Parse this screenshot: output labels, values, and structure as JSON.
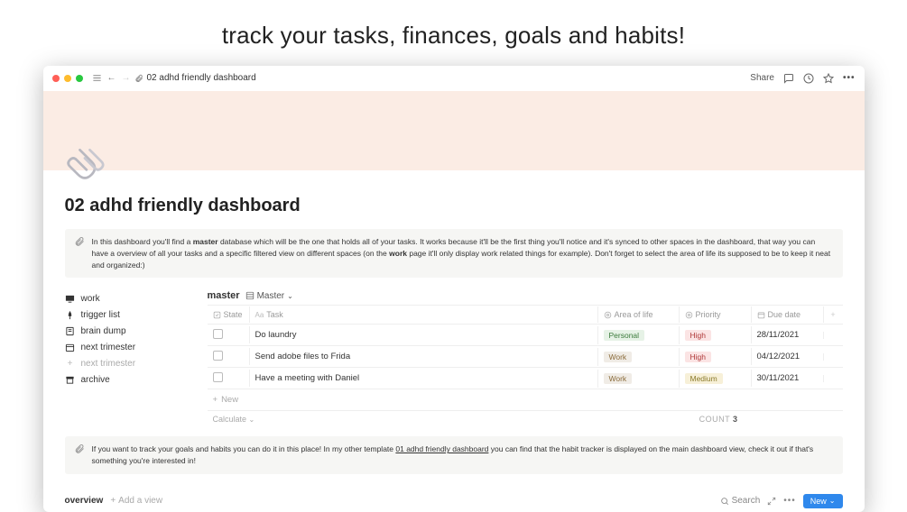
{
  "marketing_header": "track your tasks, finances, goals and habits!",
  "topbar": {
    "breadcrumb_title": "02 adhd friendly dashboard",
    "share_label": "Share"
  },
  "page": {
    "title": "02 adhd friendly dashboard"
  },
  "callout1": {
    "text_before": "In this dashboard you'll find a ",
    "bold1": "master",
    "text_mid": " database which will be the one that holds all of your tasks. It works because it'll be the first thing you'll notice and it's synced to other spaces in the dashboard, that way you can have a overview of all your tasks and a specific filtered view on different spaces (on the ",
    "bold2": "work",
    "text_after": " page it'll only display work related things for example). Don't forget to select the area of life its supposed to be to keep it neat and organized:)"
  },
  "sidebar": {
    "items": [
      {
        "label": "work",
        "icon": "desktop"
      },
      {
        "label": "trigger list",
        "icon": "pin"
      },
      {
        "label": "brain dump",
        "icon": "note"
      },
      {
        "label": "next trimester",
        "icon": "calendar"
      },
      {
        "label": "next trimester",
        "icon": "plus",
        "muted": true
      },
      {
        "label": "archive",
        "icon": "archive"
      }
    ]
  },
  "database": {
    "title": "master",
    "view_label": "Master",
    "columns": {
      "state": "State",
      "task": "Task",
      "area": "Area of life",
      "priority": "Priority",
      "due": "Due date"
    },
    "rows": [
      {
        "task": "Do laundry",
        "area": "Personal",
        "area_class": "tag-personal",
        "priority": "High",
        "priority_class": "tag-high",
        "due": "28/11/2021"
      },
      {
        "task": "Send adobe files to Frida",
        "area": "Work",
        "area_class": "tag-work",
        "priority": "High",
        "priority_class": "tag-high",
        "due": "04/12/2021"
      },
      {
        "task": "Have a meeting with Daniel",
        "area": "Work",
        "area_class": "tag-work",
        "priority": "Medium",
        "priority_class": "tag-med",
        "due": "30/11/2021"
      }
    ],
    "new_label": "New",
    "calc_label": "Calculate",
    "count_label": "COUNT",
    "count_value": "3"
  },
  "callout2": {
    "text_before": "If you want to track your goals and habits you can do it in this place! In my other template ",
    "link": "01 adhd friendly dashboard",
    "text_after": " you can find that the habit tracker is displayed on the main dashboard view, check it out if that's something you're interested in!"
  },
  "bottom": {
    "overview_title": "overview",
    "add_view": "Add a view",
    "search": "Search",
    "new_btn": "New"
  }
}
